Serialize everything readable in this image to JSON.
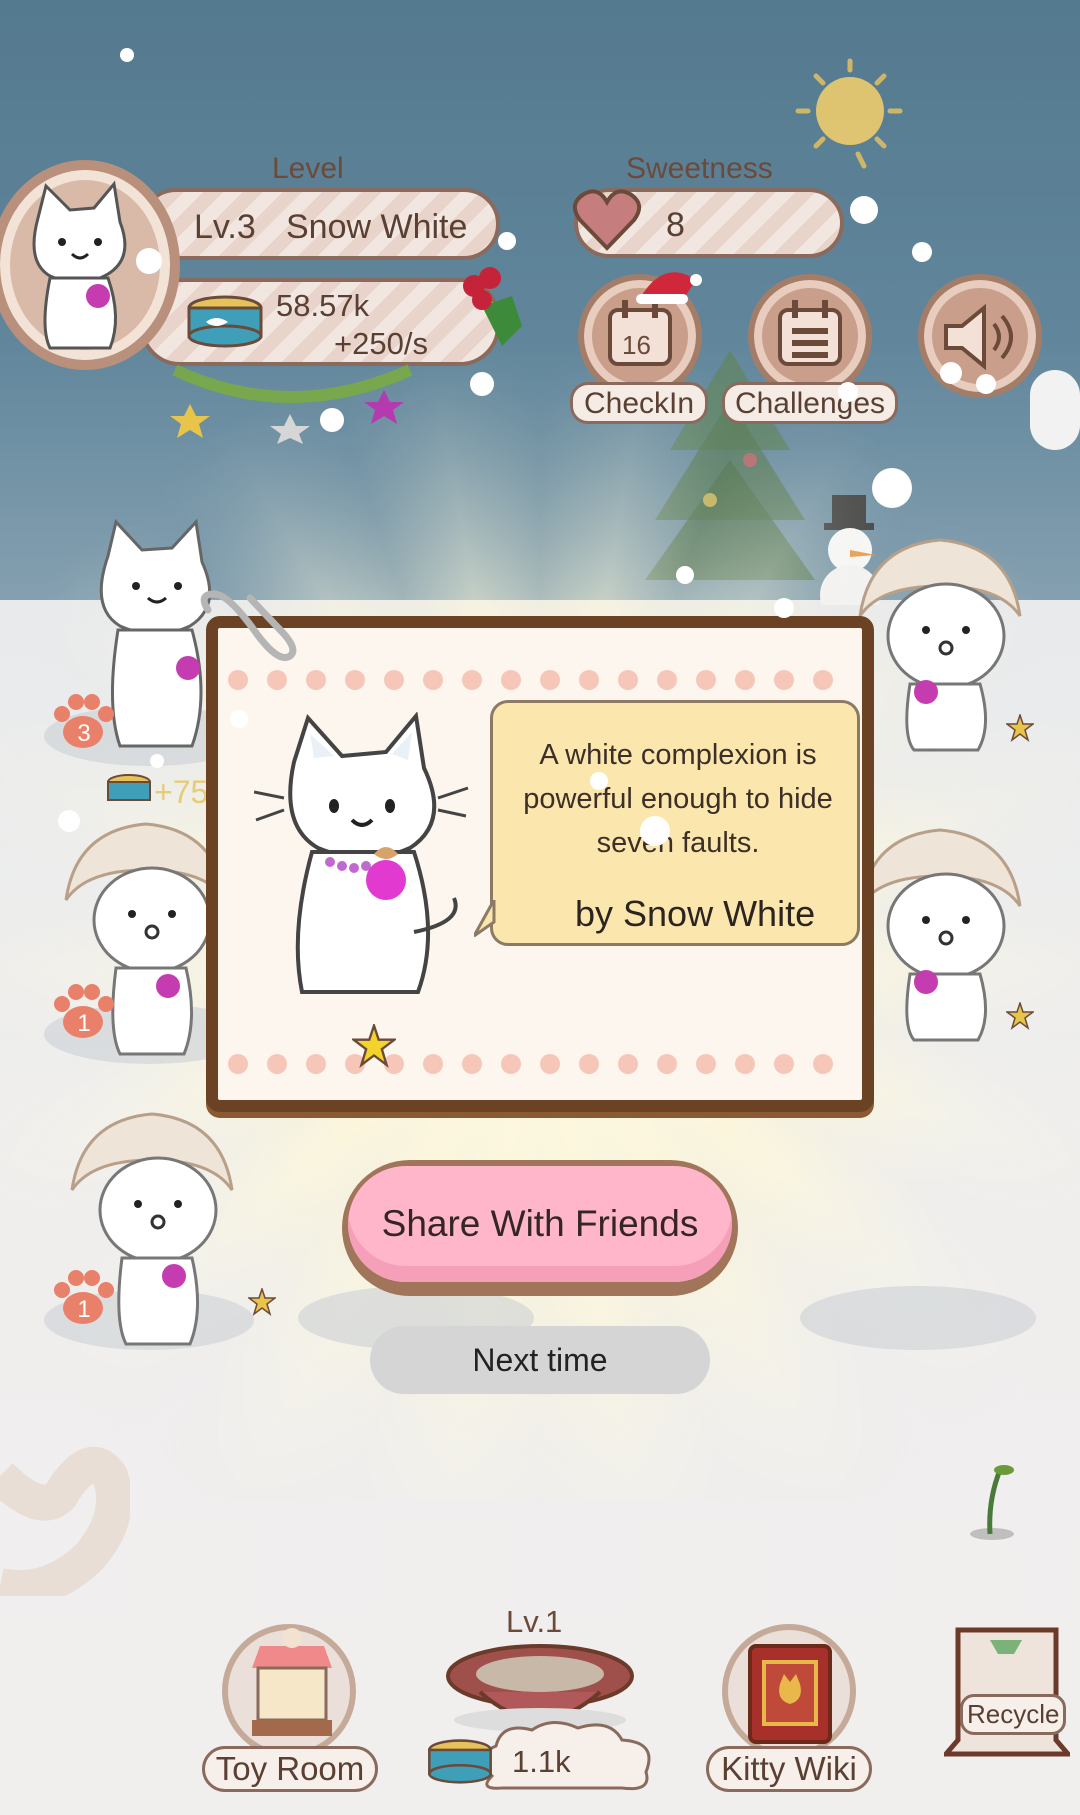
{
  "hud": {
    "level_label": "Level",
    "level_value": "Lv.3",
    "cat_name": "Snow White",
    "coins": "58.57k",
    "coins_rate": "+250/s",
    "sweetness_label": "Sweetness",
    "sweetness_value": "8",
    "checkin_label": "CheckIn",
    "checkin_day": "16",
    "challenges_label": "Challenges"
  },
  "background": {
    "coin_gain_text": "+75",
    "paw_counts": [
      "3",
      "1",
      "1"
    ]
  },
  "modal": {
    "quote": "A white complexion is powerful enough to hide seven faults.",
    "author": "by Snow White",
    "share_label": "Share With Friends",
    "next_label": "Next time"
  },
  "bottom": {
    "food_level": "Lv.1",
    "food_amount": "1.1k",
    "toy_room_label": "Toy Room",
    "kitty_wiki_label": "Kitty Wiki",
    "recycle_label": "Recycle"
  },
  "colors": {
    "sky": "#2f5d77",
    "card_border": "#6b4324",
    "speech_bubble": "#fbe7ad",
    "share_button": "#ffb6cb",
    "next_button": "#d5d5d5"
  },
  "icons": [
    "cat-avatar-icon",
    "heart-icon",
    "calendar-icon",
    "list-icon",
    "speaker-icon",
    "paw-icon",
    "star-icon",
    "food-can-icon",
    "paperclip-icon",
    "toy-shop-icon",
    "food-bowl-icon",
    "book-icon",
    "recycle-bin-icon",
    "sun-icon"
  ]
}
